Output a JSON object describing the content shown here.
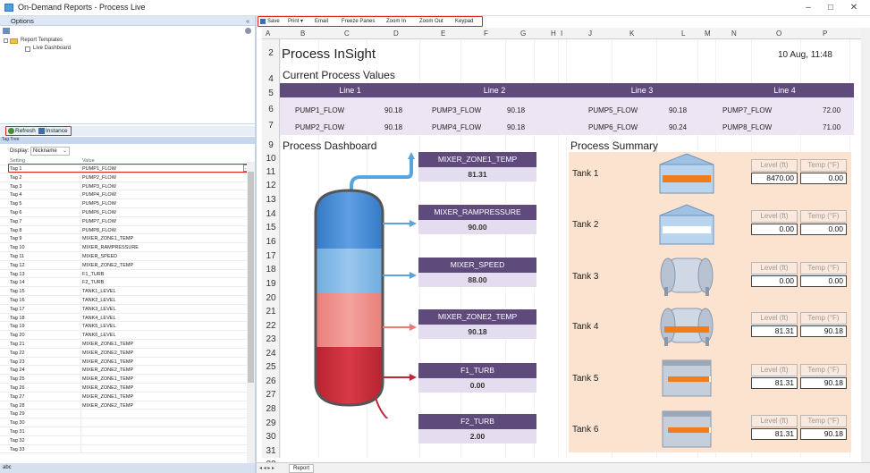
{
  "window": {
    "title": "On-Demand Reports - Process Live",
    "minimize": "–",
    "maximize": "□",
    "close": "✕"
  },
  "left": {
    "options_label": "Options",
    "collapse_glyph": "«",
    "tree_root": "Report Templates",
    "tree_child": "Live Dashboard",
    "refresh_label": "Refresh",
    "instance_label": "Instance",
    "tag_tab": "Tag Tree",
    "display_label": "Display:",
    "display_value": "Nickname",
    "col_setting": "Setting",
    "col_value": "Value",
    "rows": [
      {
        "k": "Tag 1",
        "v": "PUMP1_FLOW"
      },
      {
        "k": "Tag 2",
        "v": "PUMP2_FLOW"
      },
      {
        "k": "Tag 3",
        "v": "PUMP3_FLOW"
      },
      {
        "k": "Tag 4",
        "v": "PUMP4_FLOW"
      },
      {
        "k": "Tag 5",
        "v": "PUMP5_FLOW"
      },
      {
        "k": "Tag 6",
        "v": "PUMP6_FLOW"
      },
      {
        "k": "Tag 7",
        "v": "PUMP7_FLOW"
      },
      {
        "k": "Tag 8",
        "v": "PUMP8_FLOW"
      },
      {
        "k": "Tag 9",
        "v": "MIXER_ZONE1_TEMP"
      },
      {
        "k": "Tag 10",
        "v": "MIXER_RAMPRESSURE"
      },
      {
        "k": "Tag 11",
        "v": "MIXER_SPEED"
      },
      {
        "k": "Tag 12",
        "v": "MIXER_ZONE2_TEMP"
      },
      {
        "k": "Tag 13",
        "v": "F1_TURB"
      },
      {
        "k": "Tag 14",
        "v": "F2_TURB"
      },
      {
        "k": "Tag 15",
        "v": "TANK1_LEVEL"
      },
      {
        "k": "Tag 16",
        "v": "TANK2_LEVEL"
      },
      {
        "k": "Tag 17",
        "v": "TANK3_LEVEL"
      },
      {
        "k": "Tag 18",
        "v": "TANK4_LEVEL"
      },
      {
        "k": "Tag 19",
        "v": "TANK5_LEVEL"
      },
      {
        "k": "Tag 20",
        "v": "TANK6_LEVEL"
      },
      {
        "k": "Tag 21",
        "v": "MIXER_ZONE1_TEMP"
      },
      {
        "k": "Tag 22",
        "v": "MIXER_ZONE2_TEMP"
      },
      {
        "k": "Tag 23",
        "v": "MIXER_ZONE1_TEMP"
      },
      {
        "k": "Tag 24",
        "v": "MIXER_ZONE2_TEMP"
      },
      {
        "k": "Tag 25",
        "v": "MIXER_ZONE1_TEMP"
      },
      {
        "k": "Tag 26",
        "v": "MIXER_ZONE2_TEMP"
      },
      {
        "k": "Tag 27",
        "v": "MIXER_ZONE1_TEMP"
      },
      {
        "k": "Tag 28",
        "v": "MIXER_ZONE2_TEMP"
      },
      {
        "k": "Tag 29",
        "v": ""
      },
      {
        "k": "Tag 30",
        "v": ""
      },
      {
        "k": "Tag 31",
        "v": ""
      },
      {
        "k": "Tag 32",
        "v": ""
      },
      {
        "k": "Tag 33",
        "v": ""
      }
    ],
    "status": "abc"
  },
  "toolbar": {
    "save": "Save",
    "print": "Print ▾",
    "email": "Email",
    "freeze": "Freeze Panes",
    "zoom_in": "Zoom In",
    "zoom_out": "Zoom Out",
    "keypad": "Keypad"
  },
  "columns": [
    "A",
    "B",
    "C",
    "D",
    "E",
    "F",
    "G",
    "H",
    "I",
    "J",
    "K",
    "L",
    "M",
    "N",
    "O",
    "P"
  ],
  "rows": [
    "2",
    "4",
    "5",
    "6",
    "7",
    "9",
    "10",
    "11",
    "12",
    "13",
    "14",
    "15",
    "16",
    "17",
    "18",
    "19",
    "20",
    "21",
    "22",
    "23",
    "24",
    "25",
    "26",
    "27",
    "28",
    "29",
    "30",
    "31",
    "32",
    "33"
  ],
  "sheet": {
    "title": "Process InSight",
    "datetime": "10 Aug, 11:48",
    "current_values_heading": "Current Process Values",
    "lines": [
      {
        "name": "Line 1",
        "p1": "PUMP1_FLOW",
        "v1": "90.18",
        "p2": "PUMP2_FLOW",
        "v2": "90.18"
      },
      {
        "name": "Line 2",
        "p1": "PUMP3_FLOW",
        "v1": "90.18",
        "p2": "PUMP4_FLOW",
        "v2": "90.18"
      },
      {
        "name": "Line 3",
        "p1": "PUMP5_FLOW",
        "v1": "90.18",
        "p2": "PUMP6_FLOW",
        "v2": "90.24"
      },
      {
        "name": "Line 4",
        "p1": "PUMP7_FLOW",
        "v1": "72.00",
        "p2": "PUMP8_FLOW",
        "v2": "71.00"
      }
    ],
    "dashboard_heading": "Process Dashboard",
    "summary_heading": "Process Summary",
    "tags": [
      {
        "name": "MIXER_ZONE1_TEMP",
        "value": "81.31"
      },
      {
        "name": "MIXER_RAMPRESSURE",
        "value": "90.00"
      },
      {
        "name": "MIXER_SPEED",
        "value": "88.00"
      },
      {
        "name": "MIXER_ZONE2_TEMP",
        "value": "90.18"
      },
      {
        "name": "F1_TURB",
        "value": "0.00"
      },
      {
        "name": "F2_TURB",
        "value": "2.00"
      }
    ],
    "level_label": "Level (ft)",
    "temp_label": "Temp (°F)",
    "tanks": [
      {
        "name": "Tank 1",
        "level": "8470.00",
        "temp": "0.00",
        "shape": "silo"
      },
      {
        "name": "Tank 2",
        "level": "0.00",
        "temp": "0.00",
        "shape": "silo"
      },
      {
        "name": "Tank 3",
        "level": "0.00",
        "temp": "0.00",
        "shape": "horizontal"
      },
      {
        "name": "Tank 4",
        "level": "81.31",
        "temp": "90.18",
        "shape": "horizontal"
      },
      {
        "name": "Tank 5",
        "level": "81.31",
        "temp": "90.18",
        "shape": "box"
      },
      {
        "name": "Tank 6",
        "level": "81.31",
        "temp": "90.18",
        "shape": "box"
      }
    ],
    "tab_name": "Report",
    "tab_nav": "◂ ◂ ▸ ▸"
  },
  "colors": {
    "purple": "#5e4a7b",
    "accent_red": "#d9261c",
    "summary_bg": "#fbe3d0",
    "tank_orange": "#f07d1a"
  }
}
